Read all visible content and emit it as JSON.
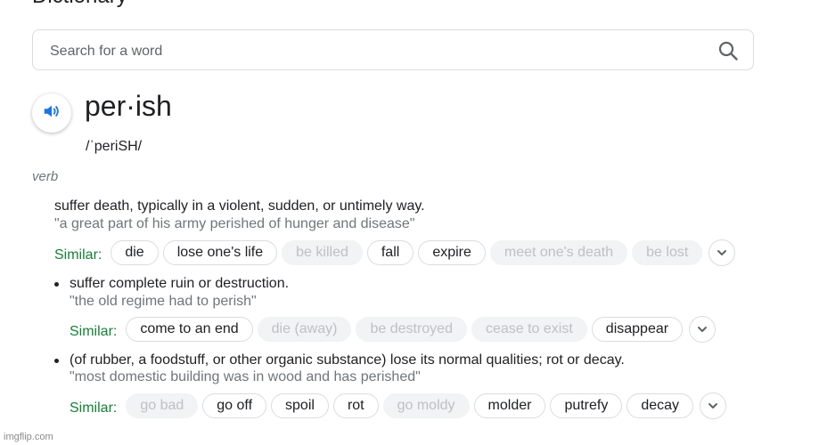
{
  "header": {
    "title": "Dictionary"
  },
  "search": {
    "placeholder": "Search for a word",
    "value": ""
  },
  "entry": {
    "word": "per·ish",
    "phonetic": "/ˈperiSH/",
    "part_of_speech": "verb"
  },
  "definitions": [
    {
      "text": "suffer death, typically in a violent, sudden, or untimely way.",
      "example": "\"a great part of his army perished of hunger and disease\"",
      "similar_label": "Similar:",
      "similar": [
        {
          "word": "die",
          "enabled": true
        },
        {
          "word": "lose one's life",
          "enabled": true
        },
        {
          "word": "be killed",
          "enabled": false
        },
        {
          "word": "fall",
          "enabled": true
        },
        {
          "word": "expire",
          "enabled": true
        },
        {
          "word": "meet one's death",
          "enabled": false
        },
        {
          "word": "be lost",
          "enabled": false
        }
      ]
    },
    {
      "text": "suffer complete ruin or destruction.",
      "example": "\"the old regime had to perish\"",
      "similar_label": "Similar:",
      "similar": [
        {
          "word": "come to an end",
          "enabled": true
        },
        {
          "word": "die (away)",
          "enabled": false
        },
        {
          "word": "be destroyed",
          "enabled": false
        },
        {
          "word": "cease to exist",
          "enabled": false
        },
        {
          "word": "disappear",
          "enabled": true
        }
      ]
    },
    {
      "text": "(of rubber, a foodstuff, or other organic substance) lose its normal qualities; rot or decay.",
      "example": "\"most domestic building was in wood and has perished\"",
      "similar_label": "Similar:",
      "similar": [
        {
          "word": "go bad",
          "enabled": false
        },
        {
          "word": "go off",
          "enabled": true
        },
        {
          "word": "spoil",
          "enabled": true
        },
        {
          "word": "rot",
          "enabled": true
        },
        {
          "word": "go moldy",
          "enabled": false
        },
        {
          "word": "molder",
          "enabled": true
        },
        {
          "word": "putrefy",
          "enabled": true
        },
        {
          "word": "decay",
          "enabled": true
        }
      ]
    }
  ],
  "watermark": "imgflip.com",
  "colors": {
    "accent_blue": "#1a73e8",
    "similar_green": "#188038",
    "muted_text": "#70757a",
    "chip_disabled_bg": "#f1f3f4"
  },
  "icons": {
    "search": "search-icon",
    "speaker": "speaker-icon",
    "expand": "chevron-down-icon"
  }
}
